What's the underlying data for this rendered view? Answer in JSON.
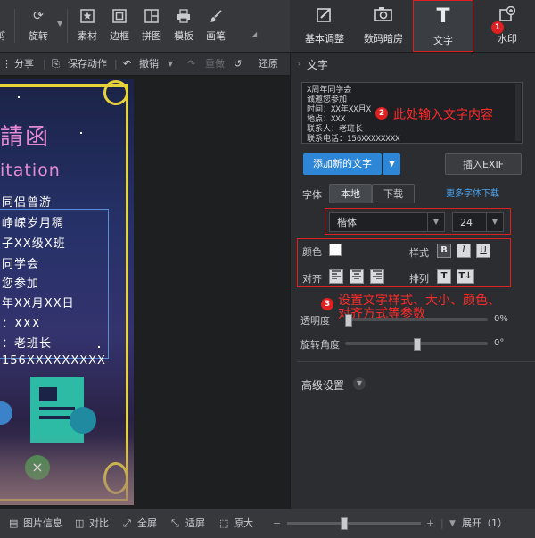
{
  "toolbar": {
    "items": [
      {
        "label": "旋转",
        "icon": "rotate-icon"
      },
      {
        "label": "素材",
        "icon": "star-icon"
      },
      {
        "label": "边框",
        "icon": "frame-icon"
      },
      {
        "label": "拼图",
        "icon": "collage-icon"
      },
      {
        "label": "模板",
        "icon": "printer-icon"
      },
      {
        "label": "画笔",
        "icon": "brush-icon"
      }
    ],
    "partial_left_label": "剪"
  },
  "subbar": {
    "share": "分享",
    "save_action": "保存动作",
    "undo": "撤销",
    "redo": "重做",
    "restore": "还原"
  },
  "poster": {
    "title_top": "請函",
    "title_en": "itation",
    "lines": [
      "同侣曾游",
      "峥嵘岁月稠",
      "子XX级X班",
      "同学会",
      "您参加",
      "年XX月XX日",
      "：XXX",
      "：老班长",
      "156XXXXXXXXX"
    ]
  },
  "right_tabs": [
    {
      "label": "基本调整",
      "icon": "adjust-icon"
    },
    {
      "label": "数码暗房",
      "icon": "camera-icon"
    },
    {
      "label": "文字",
      "icon": "text-icon"
    },
    {
      "label": "水印",
      "icon": "watermark-icon"
    }
  ],
  "panel": {
    "section_title": "文字",
    "textarea_lines": [
      "X周年同学会",
      "诚邀您参加",
      "时间：XX年XX月X",
      "地点：XXX",
      "联系人：老班长",
      "联系电话：156XXXXXXXX"
    ],
    "add_text_button": "添加新的文字",
    "insert_exif_button": "插入EXIF",
    "font_label": "字体",
    "font_tab_local": "本地",
    "font_tab_download": "下载",
    "more_fonts_link": "更多字体下载",
    "font_family_value": "楷体",
    "font_size_value": "24",
    "color_label": "颜色",
    "style_label": "样式",
    "bold": "B",
    "italic": "I",
    "underline": "U",
    "align_label": "对齐",
    "arrange_label": "排列",
    "opacity_label": "透明度",
    "opacity_value": "0%",
    "rotation_label": "旋转角度",
    "rotation_value": "0°",
    "advanced_label": "高级设置"
  },
  "annotations": {
    "a1_badge": "1",
    "a2_badge": "2",
    "a2_text": "此处输入文字内容",
    "a3_badge": "3",
    "a3_line1": "设置文字样式、大小、颜色、",
    "a3_line2": "对齐方式等参数"
  },
  "bottom": {
    "image_info": "图片信息",
    "compare": "对比",
    "fullscreen": "全屏",
    "fit": "适屏",
    "original": "原大",
    "expand": "展开（1）",
    "zoom_level": 0.42
  },
  "colors": {
    "accent_blue": "#2e86d6",
    "annotation_red": "#e02020",
    "link_blue": "#4aa3f0"
  }
}
